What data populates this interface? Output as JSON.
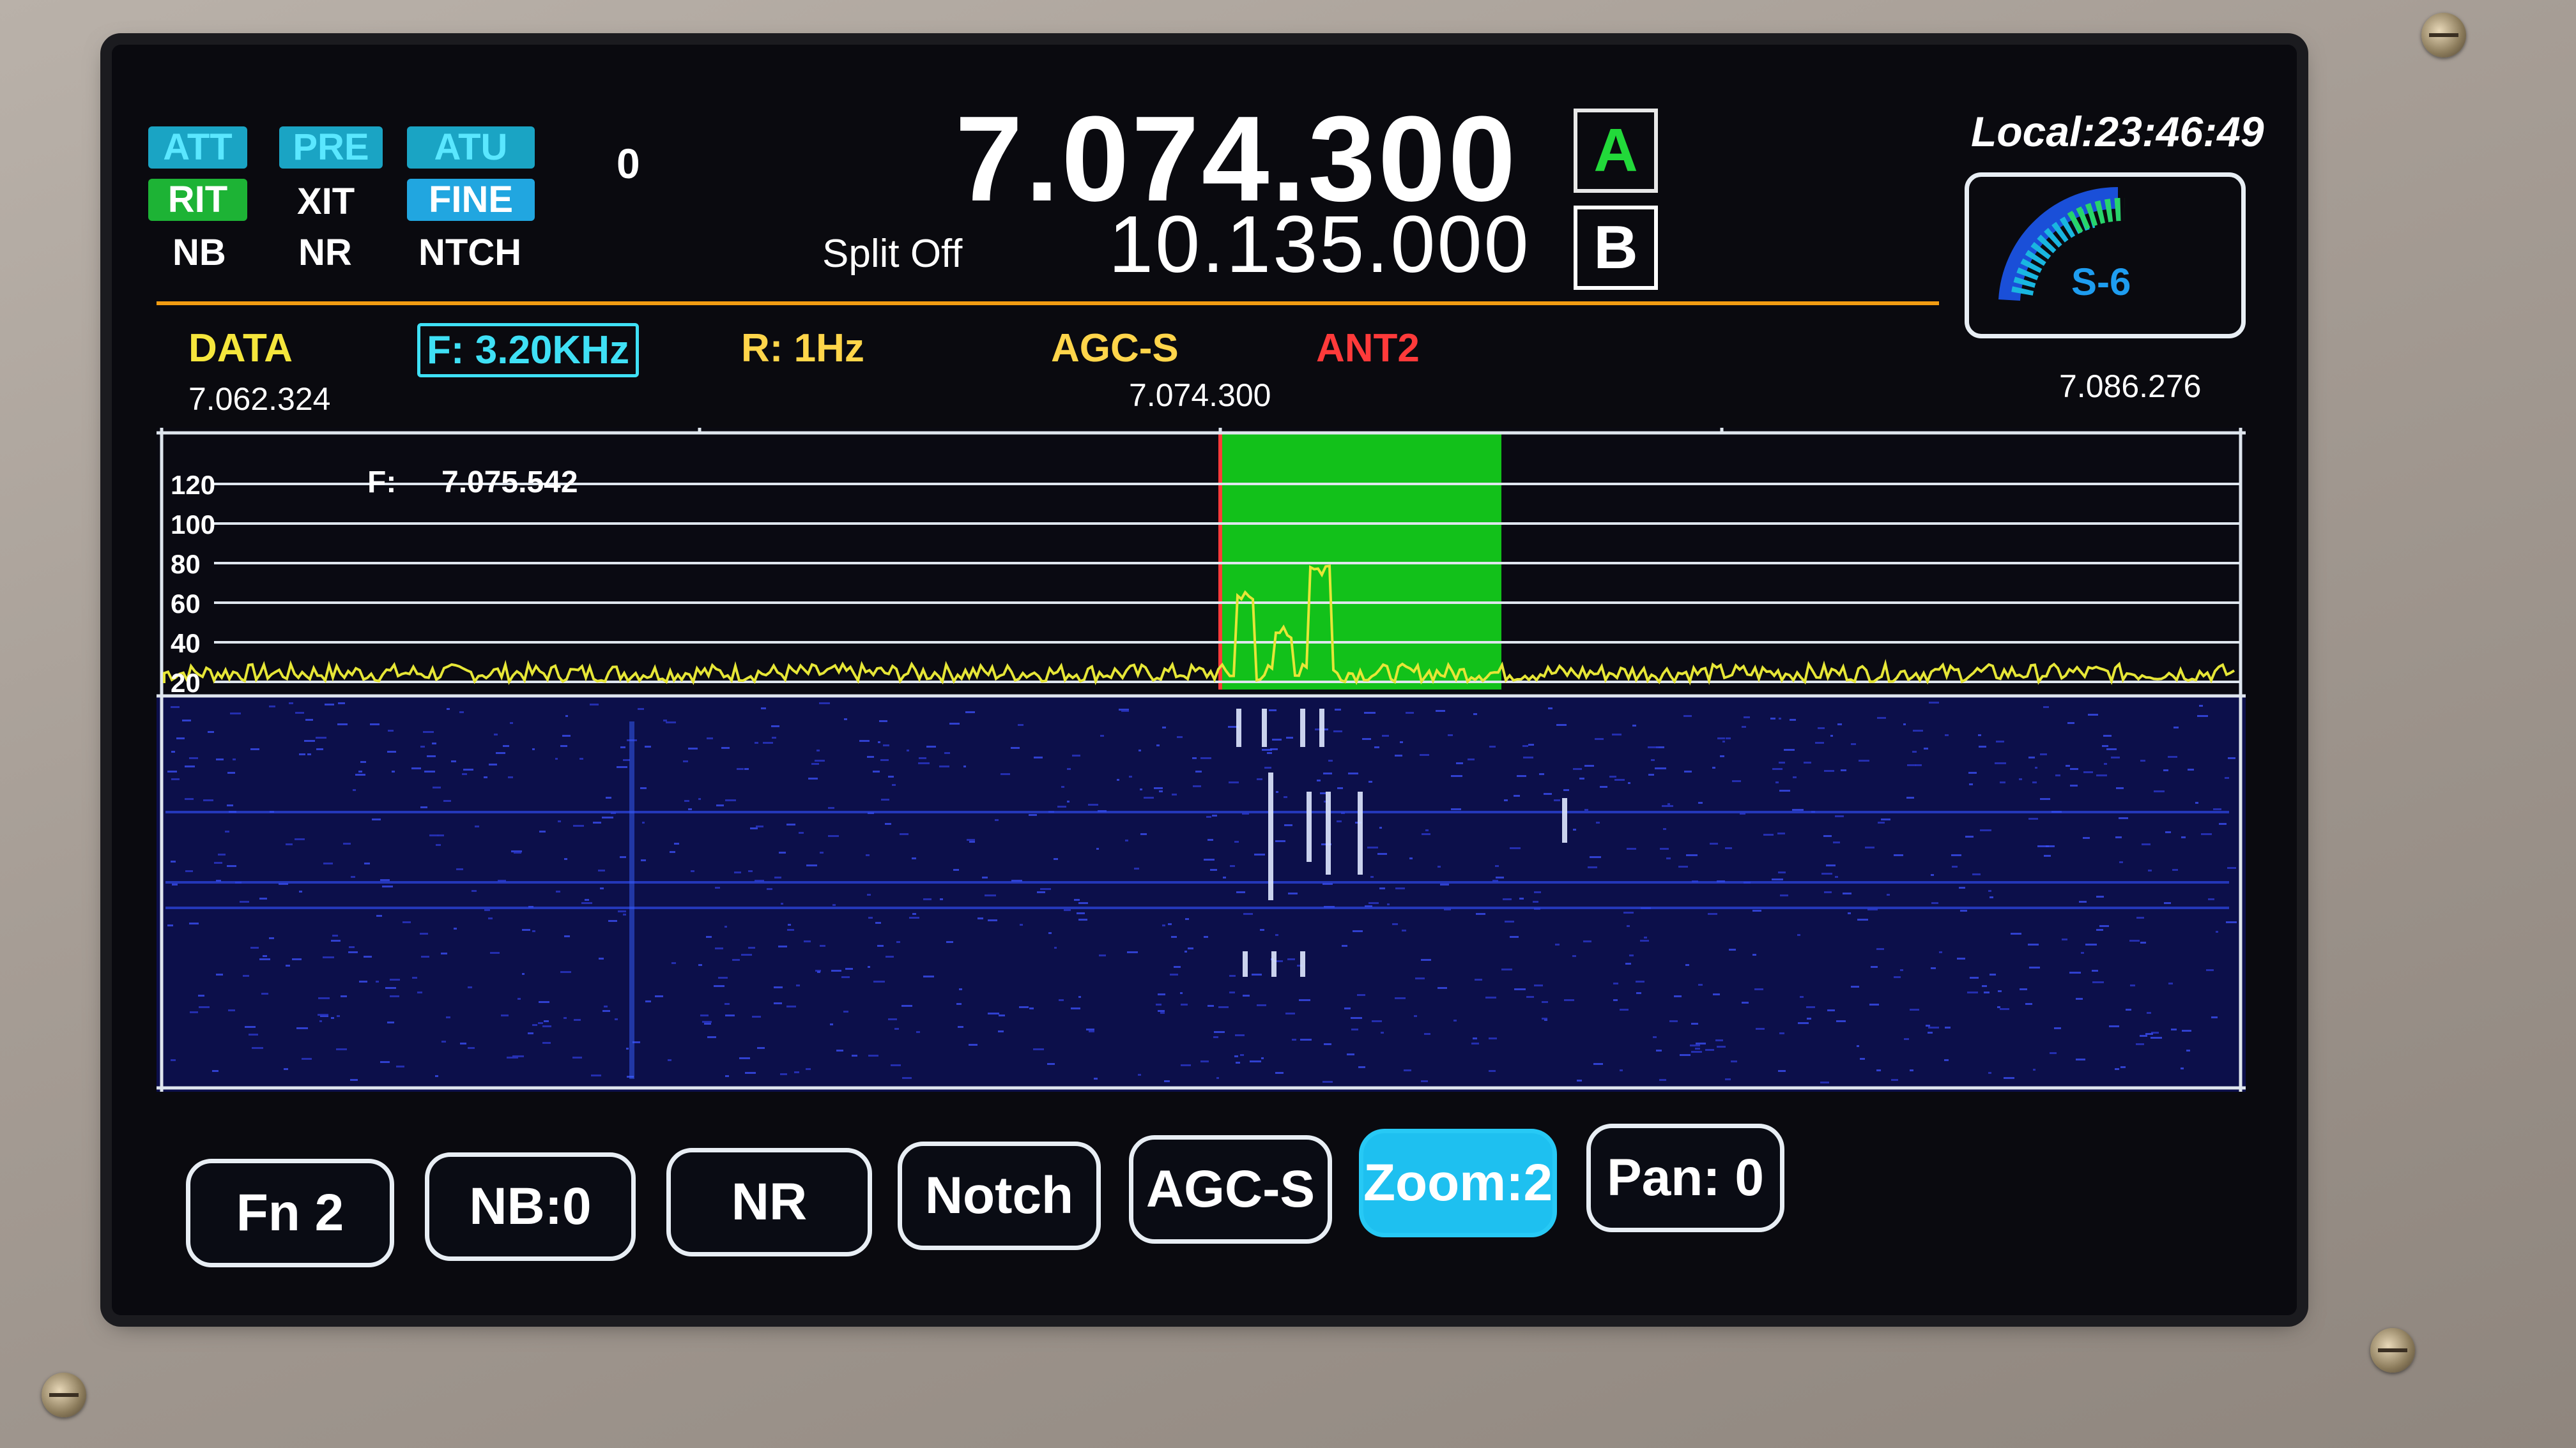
{
  "top_badges": {
    "att": "ATT",
    "pre": "PRE",
    "atu": "ATU",
    "rit": "RIT",
    "xit": "XIT",
    "fine": "FINE",
    "nb": "NB",
    "nr": "NR",
    "ntch": "NTCH",
    "counter": "0"
  },
  "vfo": {
    "freq_a": "7.074.300",
    "freq_b": "10.135.000",
    "label_a": "A",
    "label_b": "B",
    "split": "Split Off"
  },
  "clock": "Local:23:46:49",
  "s_meter": {
    "reading": "S-6",
    "level_fraction": 0.55
  },
  "status_line": {
    "mode": "DATA",
    "filter": "F: 3.20KHz",
    "rate": "R: 1Hz",
    "agc": "AGC-S",
    "antenna": "ANT2"
  },
  "scale": {
    "left": "7.062.324",
    "center": "7.074.300",
    "right": "7.086.276"
  },
  "spectrum": {
    "cursor_label": "F:",
    "cursor_freq": "7.075.542",
    "db_ticks": [
      "120",
      "100",
      "80",
      "60",
      "40",
      "20"
    ]
  },
  "buttons": [
    {
      "label": "Fn 2"
    },
    {
      "label": "NB:0"
    },
    {
      "label": "NR"
    },
    {
      "label": "Notch"
    },
    {
      "label": "AGC-S"
    },
    {
      "label": "Zoom:2"
    },
    {
      "label": "Pan:  0"
    }
  ],
  "colors": {
    "passband": "#12c11a",
    "trace": "#e6e637",
    "grid": "#dfe6ee",
    "waterfall_bg": "#0c0f4a",
    "accent_cyan": "#1ec0f0",
    "orange_rule": "#f29c12",
    "antenna_red": "#ff3a3a",
    "agc_yellow": "#ffd54a"
  }
}
